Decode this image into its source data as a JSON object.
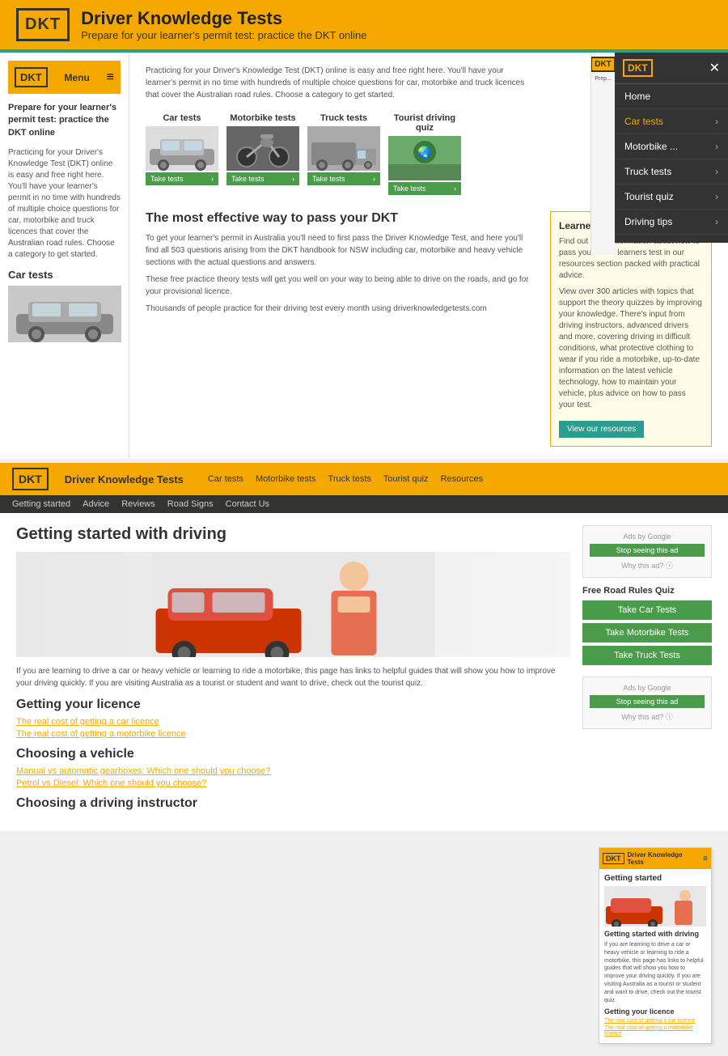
{
  "site": {
    "logo": "DKT",
    "title": "Driver Knowledge Tests",
    "tagline": "Prepare for your learner's permit test: practice the DKT online"
  },
  "banner": {
    "logo": "DKT",
    "title": "Driver Knowledge Tests",
    "subtitle": "Prepare for your learner's permit test: practice the DKT online"
  },
  "sidebar": {
    "menu_label": "Menu",
    "tagline": "Prepare for your learner's permit test: practice the DKT online",
    "description": "Practicing for your Driver's Knowledge Test (DKT) online is easy and free right here. You'll have your learner's permit in no time with hundreds of multiple choice questions for car, motorbike and truck licences that cover the Australian road rules. Choose a category to get started.",
    "section_title": "Car tests"
  },
  "test_categories": [
    {
      "title": "Car tests",
      "btn_label": "Take tests"
    },
    {
      "title": "Motorbike tests",
      "btn_label": "Take tests"
    },
    {
      "title": "Truck tests",
      "btn_label": "Take tests"
    },
    {
      "title": "Tourist driving quiz",
      "btn_label": "Take tests"
    }
  ],
  "intro": "Practicing for your Driver's Knowledge Test (DKT) online is easy and free right here. You'll have your learner's permit in no time with hundreds of multiple choice questions for car, motorbike and truck licences that cover the Australian road rules. Choose a category to get started.",
  "effective_way": {
    "title": "The most effective way to pass your DKT",
    "p1": "To get your learner's permit in Australia you'll need to first pass the Driver Knowledge Test, and here you'll find all 503 questions arising from the DKT handbook for NSW including car, motorbike and heavy vehicle sections with the actual questions and answers.",
    "p2": "These free practice theory tests will get you well on your way to being able to drive on the roads, and go for your provisional licence.",
    "p3": "Thousands of people practice for their driving test every month using driverknowledgetests.com"
  },
  "learners_resources": {
    "title": "Learners' resources",
    "p1": "Find out more information about how to pass your NSW learners test in our resources section packed with practical advice.",
    "p2": "View over 300 articles with topics that support the theory quizzes by improving your knowledge. There's input from driving instructors, advanced drivers and more, covering driving in difficult conditions, what protective clothing to wear if you ride a motorbike, up-to-date information on the latest vehicle technology, how to maintain your vehicle, plus advice on how to pass your test.",
    "btn_label": "View our resources"
  },
  "overlay_menu": {
    "logo": "DKT",
    "items": [
      {
        "label": "Home",
        "active": false
      },
      {
        "label": "Car tests",
        "active": true
      },
      {
        "label": "Motorbike ...",
        "active": false
      },
      {
        "label": "Truck tests",
        "active": false
      },
      {
        "label": "Tourist quiz",
        "active": false
      },
      {
        "label": "Driving tips",
        "active": false
      }
    ]
  },
  "nav": {
    "logo": "DKT",
    "site_name": "Driver Knowledge Tests",
    "links": [
      {
        "label": "Car tests",
        "active": false
      },
      {
        "label": "Motorbike tests",
        "active": false
      },
      {
        "label": "Truck tests",
        "active": false
      },
      {
        "label": "Tourist quiz",
        "active": false
      },
      {
        "label": "Resources",
        "active": false
      }
    ],
    "sub_links": [
      {
        "label": "Getting started"
      },
      {
        "label": "Advice"
      },
      {
        "label": "Reviews"
      },
      {
        "label": "Road Signs"
      },
      {
        "label": "Contact Us"
      }
    ]
  },
  "getting_started": {
    "title": "Getting started with driving",
    "intro": "If you are learning to drive a car or heavy vehicle or learning to ride a motorbike, this page has links to helpful guides that will show you how to improve your driving quickly. If you are visiting Australia as a tourist or student and want to drive, check out the tourist quiz.",
    "sections": [
      {
        "title": "Getting your licence",
        "links": [
          "The real cost of getting a car licence",
          "The real cost of getting a motorbike licence"
        ]
      },
      {
        "title": "Choosing a vehicle",
        "links": [
          "Manual vs automatic gearboxes: Which one should you choose?",
          "Petrol vs Diesel: Which one should you choose?"
        ]
      },
      {
        "title": "Choosing a driving instructor",
        "links": []
      }
    ]
  },
  "road_rules_quiz": {
    "title": "Free Road Rules Quiz",
    "buttons": [
      {
        "label": "Take Car Tests"
      },
      {
        "label": "Take Motorbike Tests"
      },
      {
        "label": "Take Truck Tests"
      }
    ]
  },
  "ads": {
    "label": "Ads by Google",
    "stop_label": "Stop seeing this ad",
    "why_label": "Why this ad? ⓘ"
  },
  "mini_browser": {
    "logo": "DKT",
    "site_name": "Driver Knowledge Tests",
    "section": "Getting started",
    "title": "Getting started with driving",
    "intro": "If you are learning to drive a car or heavy vehicle or learning to ride a motorbike, this page has links to helpful guides that will show you how to improve your driving quickly. If you are visiting Australia as a tourist or student and want to drive, check out the tourist quiz.",
    "licence_title": "Getting your licence",
    "links": [
      "The real cost of getting a car licence",
      "The real cost of getting a motorbike licence"
    ]
  }
}
